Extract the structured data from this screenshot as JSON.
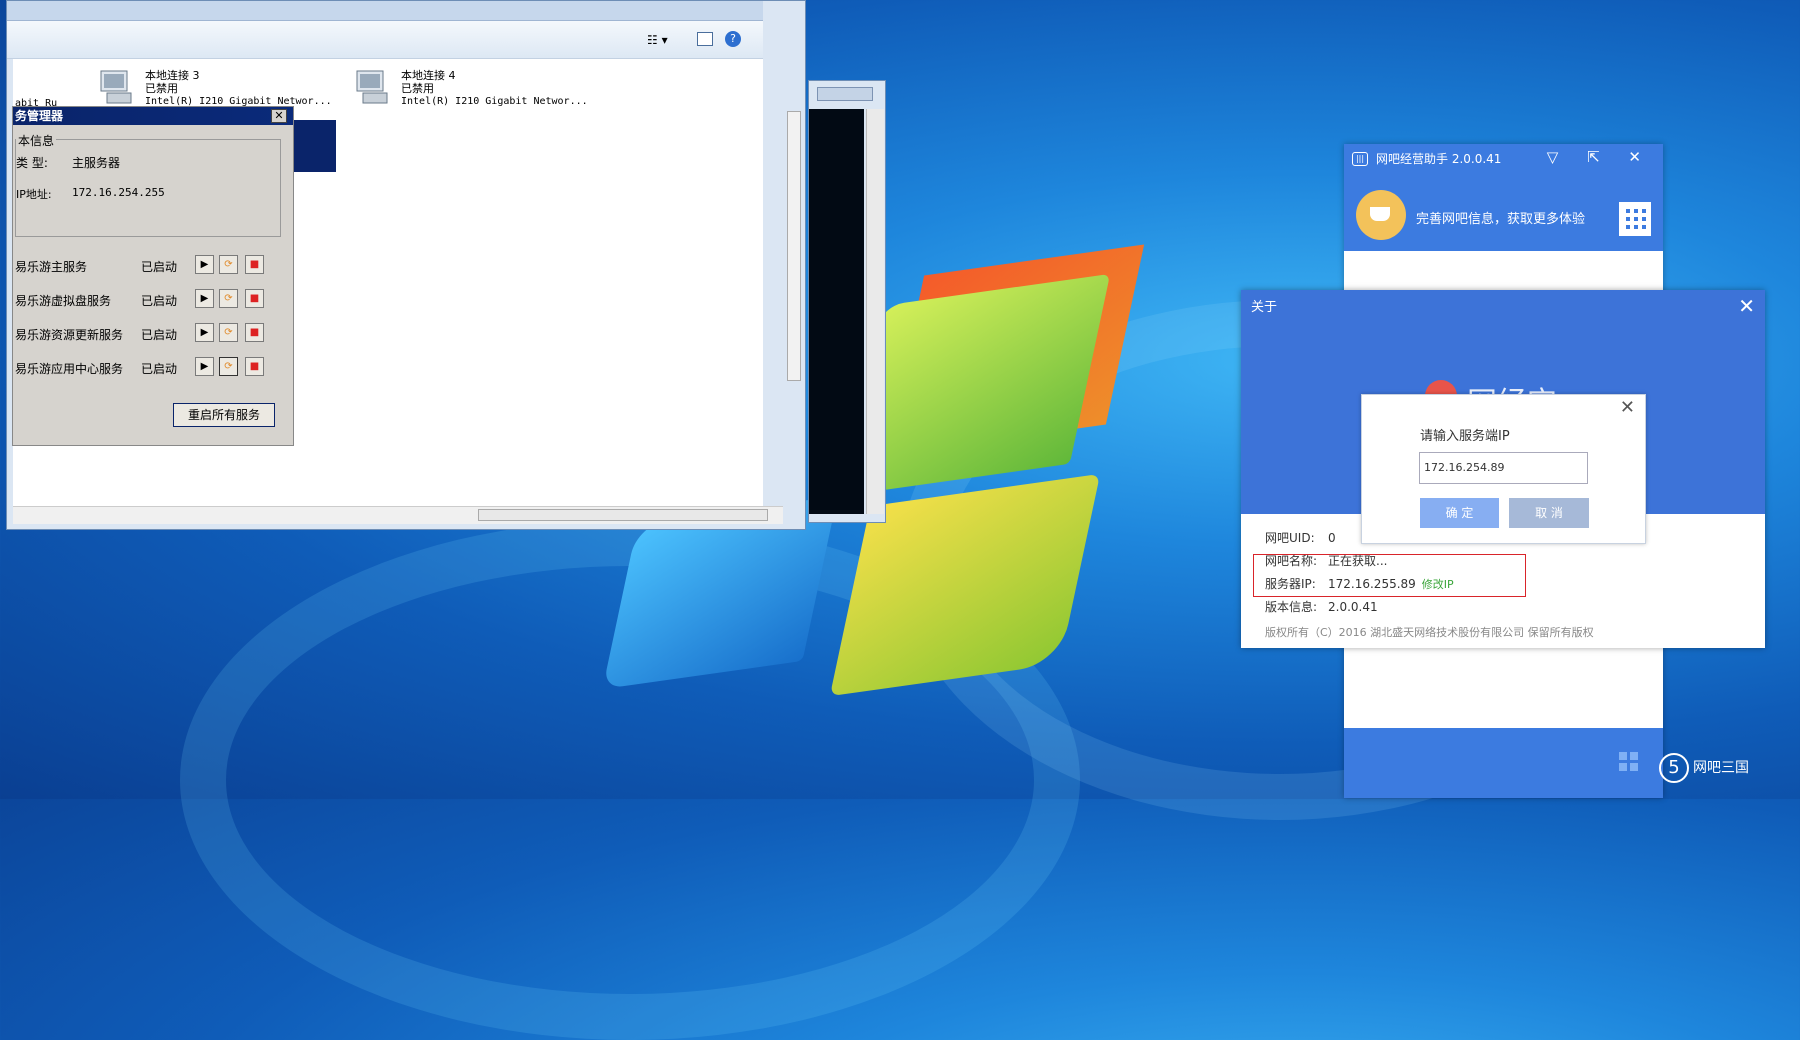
{
  "explorer": {
    "connections": [
      {
        "name": "本地连接 3",
        "status": "已禁用",
        "adapter": "Intel(R) I210 Gigabit Networ..."
      },
      {
        "name": "本地连接 4",
        "status": "已禁用",
        "adapter": "Intel(R) I210 Gigabit Networ..."
      }
    ],
    "cut_text": "abit Ru"
  },
  "service_dialog": {
    "title": "务管理器",
    "close_label": "✕",
    "group_label": "本信息",
    "type_label": "类 型:",
    "type_value": "主服务器",
    "ip_label": "IP地址:",
    "ip_value": "172.16.254.255",
    "services": [
      {
        "name": "易乐游主服务",
        "status": "已启动"
      },
      {
        "name": "易乐游虚拟盘服务",
        "status": "已启动"
      },
      {
        "name": "易乐游资源更新服务",
        "status": "已启动"
      },
      {
        "name": "易乐游应用中心服务",
        "status": "已启动"
      }
    ],
    "restart_label": "重启所有服务"
  },
  "assistant": {
    "title": "网吧经营助手 2.0.0.41",
    "logo_text": "|||",
    "controls": "▽ ⇱ ✕",
    "banner_text": "完善网吧信息，获取更多体验"
  },
  "about": {
    "title": "关于",
    "close_label": "✕",
    "brand": "网经宝",
    "uid_label": "网吧UID:",
    "uid_value": "0",
    "name_label": "网吧名称:",
    "name_value": "正在获取...",
    "ip_label": "服务器IP:",
    "ip_value": "172.16.255.89",
    "fix_ip_link": "修改IP",
    "version_label": "版本信息:",
    "version_value": "2.0.0.41",
    "copyright": "版权所有（C）2016 湖北盛天网络技术股份有限公司 保留所有版权"
  },
  "ip_dialog": {
    "label": "请输入服务端IP",
    "input_value": "172.16.254.89",
    "ok_label": "确 定",
    "cancel_label": "取 消",
    "close_label": "✕"
  },
  "watermark": {
    "text": "网吧三国",
    "digit": "5"
  },
  "colors": {
    "assistant_blue": "#3c7be0",
    "highlight_red": "#d9242a",
    "link_green": "#3aa53a"
  }
}
